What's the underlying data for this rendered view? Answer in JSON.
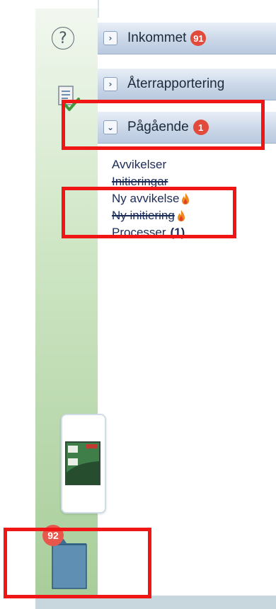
{
  "rail": {
    "help_icon_glyph": "?",
    "doc_icon": "document-check-icon"
  },
  "accordion": [
    {
      "label": "Inkommet",
      "badge": "91",
      "chevron": "›",
      "state": "collapsed"
    },
    {
      "label": "Återrapportering",
      "badge": "",
      "chevron": "›",
      "state": "collapsed"
    },
    {
      "label": "Pågående",
      "badge": "1",
      "chevron": "⌄",
      "state": "expanded"
    }
  ],
  "menu": {
    "items": [
      {
        "label": "Avvikelser"
      },
      {
        "label": "Initieringar"
      },
      {
        "label": "Ny avvikelse"
      },
      {
        "label": "Ny initiering"
      },
      {
        "label": "Processer",
        "count": "(1)"
      }
    ]
  },
  "dock": {
    "folder_badge": "92"
  },
  "colors": {
    "badge": "#e24a3c",
    "highlight": "#f01616",
    "link_text": "#1b2b57",
    "rail_green": "#b7d7ab"
  }
}
